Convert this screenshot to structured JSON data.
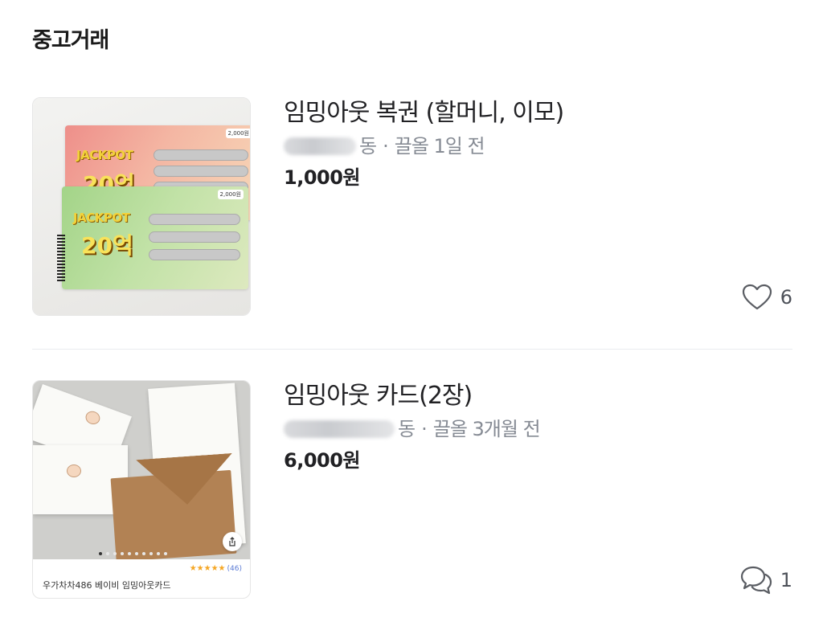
{
  "section_title": "중고거래",
  "listings": [
    {
      "title": "임밍아웃 복권 (할머니, 이모)",
      "location_suffix": "동",
      "separator": "·",
      "time": "끌올 1일 전",
      "price": "1,000원",
      "stat_icon": "heart-icon",
      "stat_count": "6",
      "thumbnail": {
        "jackpot_label": "JACKPOT",
        "prize_label": "20억",
        "ticket_price": "2,000원"
      }
    },
    {
      "title": "임밍아웃 카드(2장)",
      "location_suffix": "동",
      "separator": "·",
      "time": "끌올 3개월 전",
      "price": "6,000원",
      "stat_icon": "chat-bubbles-icon",
      "stat_count": "1",
      "thumbnail": {
        "stars": "★★★★★",
        "review_count": "(46)",
        "caption": "우가차차486 베이비 임밍아웃카드"
      }
    }
  ],
  "colors": {
    "title": "#212124",
    "meta": "#868b94",
    "divider": "#e9ecef",
    "star": "#f5a623"
  }
}
